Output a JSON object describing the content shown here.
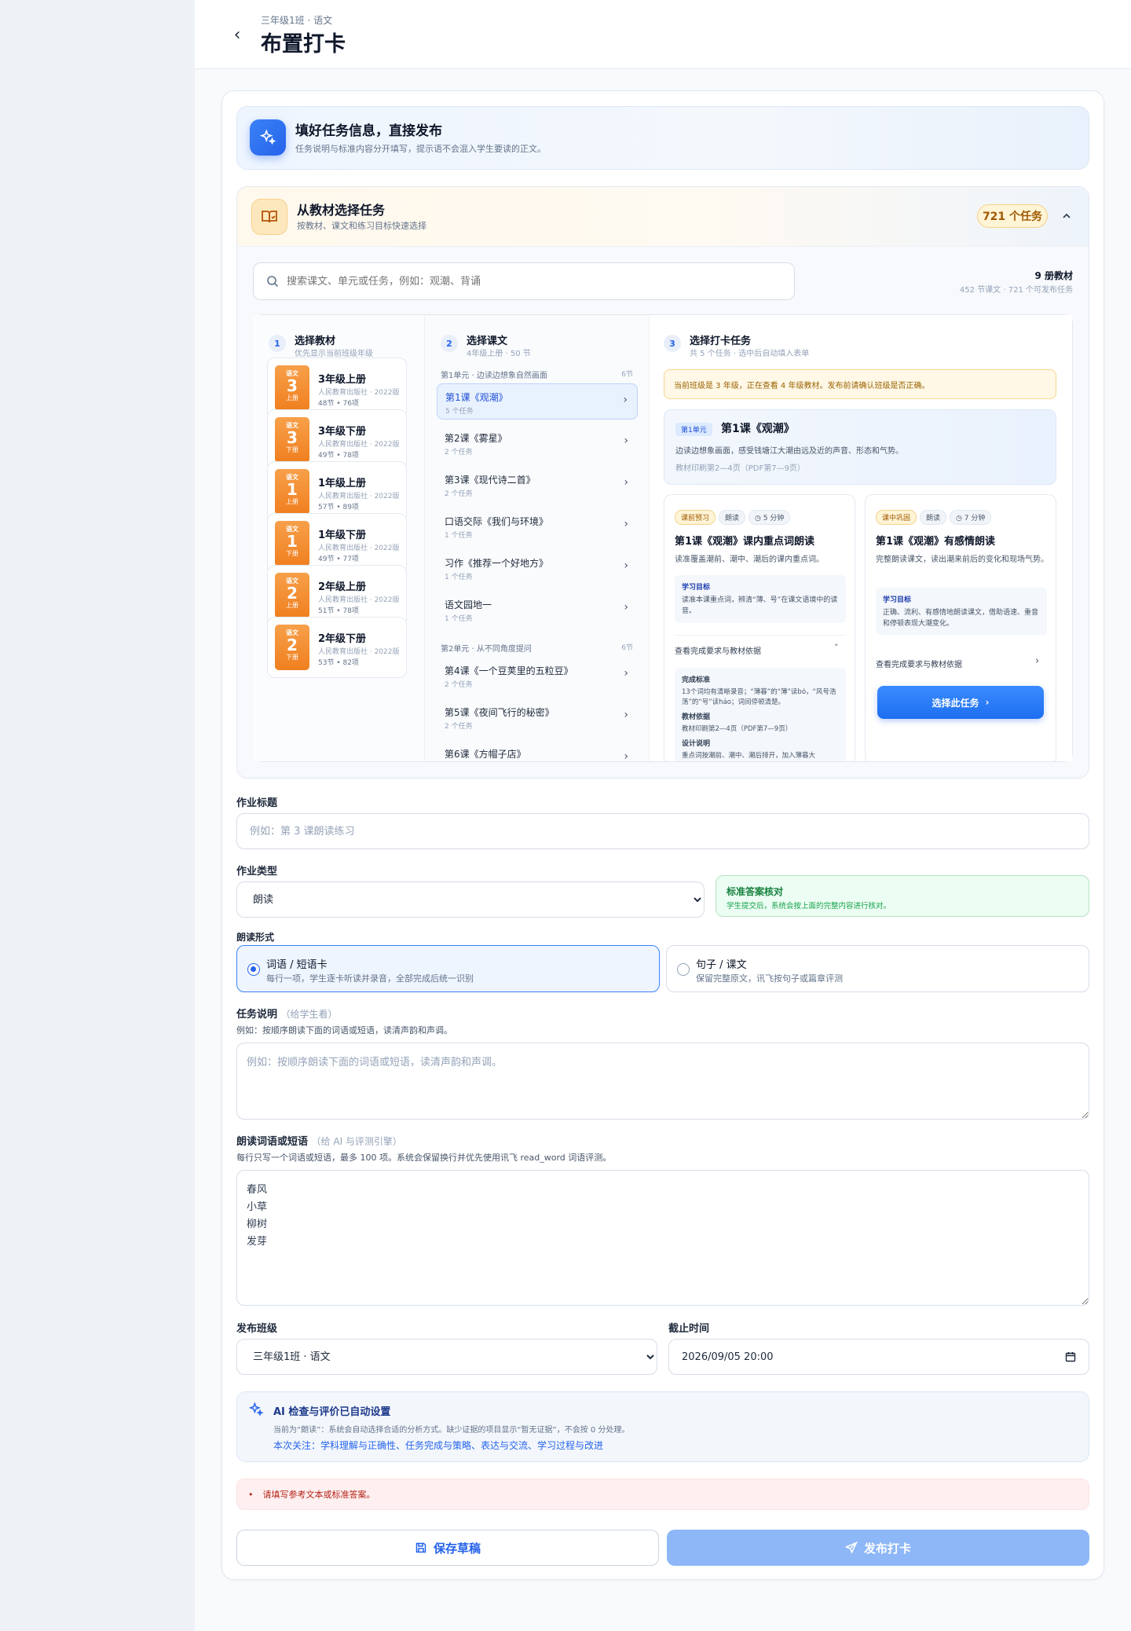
{
  "header": {
    "breadcrumb": "三年级1班 · 语文",
    "title": "布置打卡"
  },
  "hero": {
    "title": "填好任务信息，直接发布",
    "subtitle": "任务说明与标准内容分开填写，提示语不会混入学生要读的正文。"
  },
  "picker": {
    "title": "从教材选择任务",
    "subtitle": "按教材、课文和练习目标快速选择",
    "task_count": "721 个任务",
    "search_placeholder": "搜索课文、单元或任务，例如：观潮、背诵",
    "stats_main": "9 册教材",
    "stats_sub": "452 节课文 · 721 个可发布任务",
    "col1": {
      "num": "1",
      "title": "选择教材",
      "sub": "优先显示当前班级年级"
    },
    "col2": {
      "num": "2",
      "title": "选择课文",
      "sub": "4年级上册 · 50 节"
    },
    "col3": {
      "num": "3",
      "title": "选择打卡任务",
      "sub": "共 5 个任务 · 选中后自动填入表单"
    },
    "books": [
      {
        "tag": "语文",
        "grade": "3",
        "term": "上册",
        "title": "3年级上册",
        "publisher": "人民教育出版社 · 2022版",
        "counts": "48节 • 76项"
      },
      {
        "tag": "语文",
        "grade": "3",
        "term": "下册",
        "title": "3年级下册",
        "publisher": "人民教育出版社 · 2022版",
        "counts": "49节 • 78项"
      },
      {
        "tag": "语文",
        "grade": "1",
        "term": "上册",
        "title": "1年级上册",
        "publisher": "人民教育出版社 · 2022版",
        "counts": "57节 • 89项"
      },
      {
        "tag": "语文",
        "grade": "1",
        "term": "下册",
        "title": "1年级下册",
        "publisher": "人民教育出版社 · 2022版",
        "counts": "49节 • 77项"
      },
      {
        "tag": "语文",
        "grade": "2",
        "term": "上册",
        "title": "2年级上册",
        "publisher": "人民教育出版社 · 2022版",
        "counts": "51节 • 78项"
      },
      {
        "tag": "语文",
        "grade": "2",
        "term": "下册",
        "title": "2年级下册",
        "publisher": "人民教育出版社 · 2022版",
        "counts": "53节 • 82项"
      }
    ],
    "units": [
      {
        "title": "第1单元 · 边读边想象自然画面",
        "count": "6节"
      },
      {
        "title": "第2单元 · 从不同角度提问",
        "count": "6节"
      }
    ],
    "lessons": [
      {
        "title": "第1课《观潮》",
        "sub": "5 个任务"
      },
      {
        "title": "第2课《雾星》",
        "sub": "2 个任务"
      },
      {
        "title": "第3课《现代诗二首》",
        "sub": "2 个任务"
      },
      {
        "title": "口语交际《我们与环境》",
        "sub": "1 个任务"
      },
      {
        "title": "习作《推荐一个好地方》",
        "sub": "1 个任务"
      },
      {
        "title": "语文园地一",
        "sub": "1 个任务"
      },
      {
        "title": "第4课《一个豆荚里的五粒豆》",
        "sub": "2 个任务"
      },
      {
        "title": "第5课《夜间飞行的秘密》",
        "sub": "2 个任务"
      },
      {
        "title": "第6课《方帽子店》",
        "sub": "2 个任务"
      }
    ],
    "warning": "当前班级是 3 年级，正在查看 4 年级教材。发布前请确认班级是否正确。",
    "lesson_card": {
      "unit": "第1单元",
      "title": "第1课《观潮》",
      "desc": "边读边想象画面，感受钱塘江大潮由远及近的声音、形态和气势。",
      "pages": "教材印刷第2—4页（PDF第7—9页）"
    },
    "tasks": [
      {
        "chips": [
          "课前预习",
          "朗读",
          "5 分钟"
        ],
        "title": "第1课《观潮》课内重点词朗读",
        "desc": "读准覆盖潮前、潮中、潮后的课内重点词。",
        "goal_label": "学习目标",
        "goal": "读准本课重点词，辨清“薄、号”在课文语境中的读音。",
        "link": "查看完成要求与教材依据",
        "std_label": "完成标准",
        "std": "13个词均有清晰录音；“薄暮”的“薄”读bó，“风号浩荡”的“号”读háo；词间停顿清楚。",
        "basis_label": "教材依据",
        "basis": "教材印刷第2—4页（PDF第7—9页）",
        "design_label": "设计说明",
        "design": "重点词按潮前、潮中、潮后排开，加入薄暮大"
      },
      {
        "chips": [
          "课中巩固",
          "朗读",
          "7 分钟"
        ],
        "title": "第1课《观潮》有感情朗读",
        "desc": "完整朗读课文，读出潮来前后的变化和现场气势。",
        "goal_label": "学习目标",
        "goal": "正确、流利、有感情地朗读课文，借助语速、重音和停顿表现大潮变化。",
        "link": "查看完成要求与教材依据",
        "button": "选择此任务"
      }
    ]
  },
  "form": {
    "title_label": "作业标题",
    "title_placeholder": "例如：第 3 课朗读练习",
    "type_label": "作业类型",
    "type_value": "朗读",
    "answer_title": "标准答案核对",
    "answer_sub": "学生提交后，系统会按上面的完整内容进行核对。",
    "mode_label": "朗读形式",
    "modes": [
      {
        "title": "词语 / 短语卡",
        "sub": "每行一项，学生逐卡听读并录音，全部完成后统一识别"
      },
      {
        "title": "句子 / 课文",
        "sub": "保留完整原文，讯飞按句子或篇章评测"
      }
    ],
    "desc_label": "任务说明",
    "desc_note": "（给学生看）",
    "desc_hint": "例如：按顺序朗读下面的词语或短语，读清声韵和声调。",
    "desc_placeholder": "例如：按顺序朗读下面的词语或短语，读清声韵和声调。",
    "words_label": "朗读词语或短语",
    "words_note": "（给 AI 与评测引擎）",
    "words_hint": "每行只写一个词语或短语，最多 100 项。系统会保留换行并优先使用讯飞 read_word 词语评测。",
    "words_value": "春风\n小草\n柳树\n发芽",
    "class_label": "发布班级",
    "class_value": "三年级1班 · 语文",
    "deadline_label": "截止时间",
    "deadline_value": "2026/09/05 20:00",
    "ai_title": "AI 检查与评价已自动设置",
    "ai_line1": "当前为“朗读”：系统会自动选择合适的分析方式。缺少证据的项目显示“暂无证据”，不会按 0 分处理。",
    "ai_line2": "本次关注：学科理解与正确性、任务完成与策略、表达与交流、学习过程与改进",
    "error": "请填写参考文本或标准答案。",
    "save_label": "保存草稿",
    "publish_label": "发布打卡"
  }
}
